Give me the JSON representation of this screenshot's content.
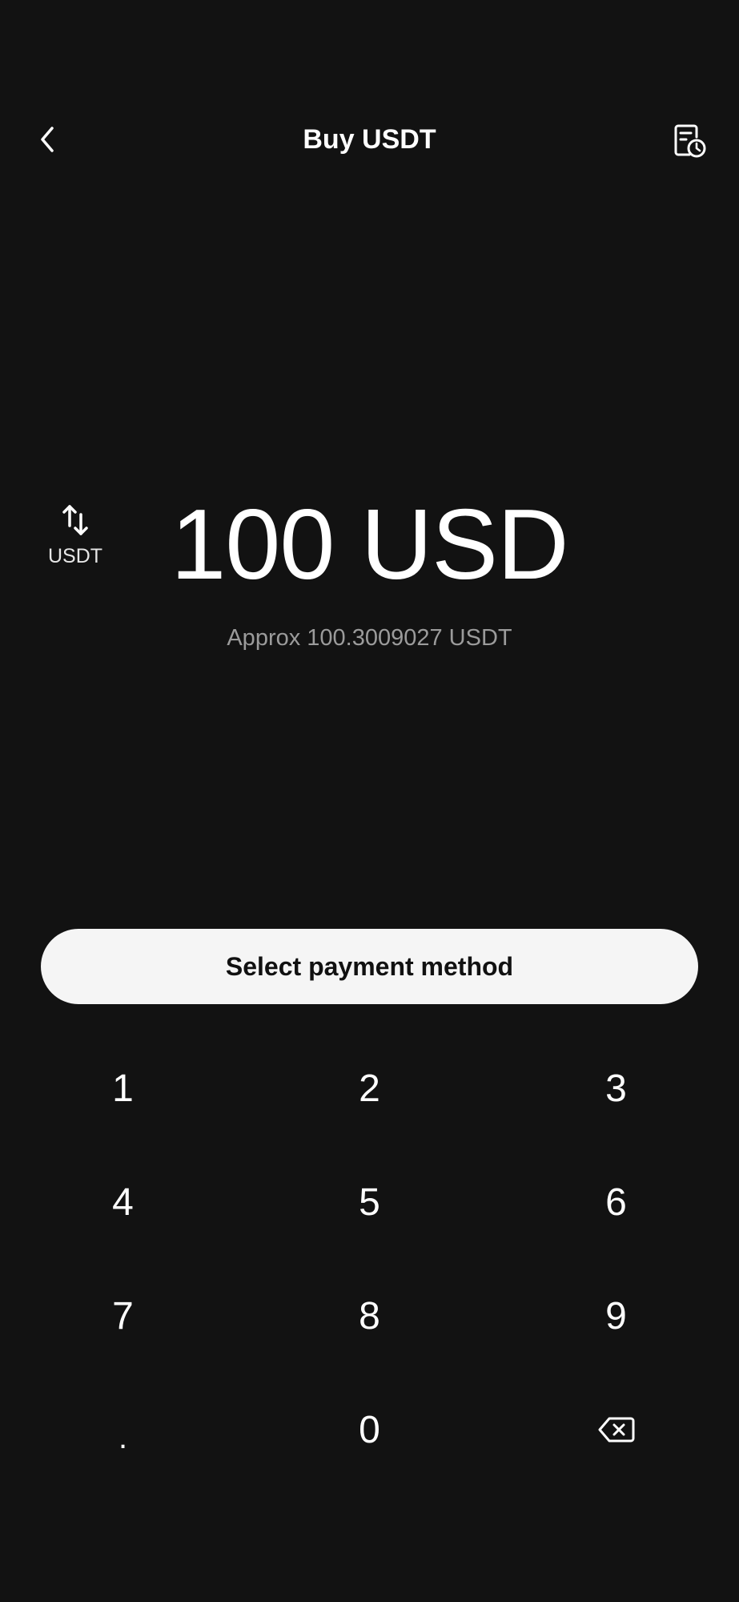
{
  "header": {
    "title": "Buy USDT",
    "back_icon": "chevron-left-icon",
    "history_icon": "order-history-icon"
  },
  "converter": {
    "switch_icon": "swap-vertical-icon",
    "switch_label": "USDT",
    "amount": "100 USD",
    "approx": "Approx 100.3009027 USDT"
  },
  "actions": {
    "select_payment_label": "Select payment method"
  },
  "keypad": {
    "keys": [
      "1",
      "2",
      "3",
      "4",
      "5",
      "6",
      "7",
      "8",
      "9",
      ".",
      "0"
    ],
    "backspace_icon": "backspace-icon"
  },
  "colors": {
    "background": "#121212",
    "text": "#ffffff",
    "muted_text": "#9b9b9b",
    "button_bg": "#f5f5f5",
    "button_text": "#111111"
  }
}
